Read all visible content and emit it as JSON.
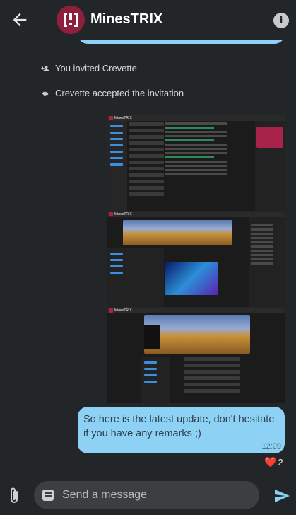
{
  "header": {
    "room_name": "MinesTRIX",
    "back_icon": "arrow-back-icon",
    "info_icon": "info-icon"
  },
  "timeline": {
    "system_events": [
      {
        "icon": "person-add-icon",
        "text": "You invited Crevette"
      },
      {
        "icon": "handshake-icon",
        "text": "Crevette accepted the invitation"
      }
    ],
    "images": [
      {
        "name": "screenshot-1",
        "label": "MinesTRIX"
      },
      {
        "name": "screenshot-2",
        "label": "MinesTRIX"
      },
      {
        "name": "screenshot-3",
        "label": "MinesTRIX"
      }
    ],
    "message": {
      "text": "So here is the latest update, don't hesitate if you have any remarks ;)",
      "time": "12:09"
    },
    "reaction": {
      "emoji": "❤️",
      "count": "2"
    }
  },
  "composer": {
    "placeholder": "Send a message",
    "attach_icon": "paperclip-icon",
    "send_icon": "send-icon"
  },
  "colors": {
    "background": "#232629",
    "bubble": "#8dd2f5",
    "accent": "#a8234a"
  }
}
